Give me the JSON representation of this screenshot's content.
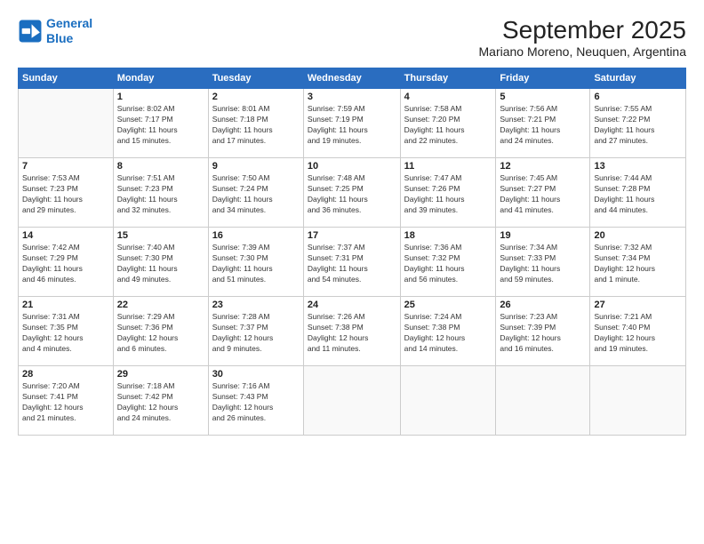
{
  "header": {
    "logo_line1": "General",
    "logo_line2": "Blue",
    "title": "September 2025",
    "subtitle": "Mariano Moreno, Neuquen, Argentina"
  },
  "days_of_week": [
    "Sunday",
    "Monday",
    "Tuesday",
    "Wednesday",
    "Thursday",
    "Friday",
    "Saturday"
  ],
  "weeks": [
    [
      {
        "num": "",
        "info": ""
      },
      {
        "num": "1",
        "info": "Sunrise: 8:02 AM\nSunset: 7:17 PM\nDaylight: 11 hours\nand 15 minutes."
      },
      {
        "num": "2",
        "info": "Sunrise: 8:01 AM\nSunset: 7:18 PM\nDaylight: 11 hours\nand 17 minutes."
      },
      {
        "num": "3",
        "info": "Sunrise: 7:59 AM\nSunset: 7:19 PM\nDaylight: 11 hours\nand 19 minutes."
      },
      {
        "num": "4",
        "info": "Sunrise: 7:58 AM\nSunset: 7:20 PM\nDaylight: 11 hours\nand 22 minutes."
      },
      {
        "num": "5",
        "info": "Sunrise: 7:56 AM\nSunset: 7:21 PM\nDaylight: 11 hours\nand 24 minutes."
      },
      {
        "num": "6",
        "info": "Sunrise: 7:55 AM\nSunset: 7:22 PM\nDaylight: 11 hours\nand 27 minutes."
      }
    ],
    [
      {
        "num": "7",
        "info": "Sunrise: 7:53 AM\nSunset: 7:23 PM\nDaylight: 11 hours\nand 29 minutes."
      },
      {
        "num": "8",
        "info": "Sunrise: 7:51 AM\nSunset: 7:23 PM\nDaylight: 11 hours\nand 32 minutes."
      },
      {
        "num": "9",
        "info": "Sunrise: 7:50 AM\nSunset: 7:24 PM\nDaylight: 11 hours\nand 34 minutes."
      },
      {
        "num": "10",
        "info": "Sunrise: 7:48 AM\nSunset: 7:25 PM\nDaylight: 11 hours\nand 36 minutes."
      },
      {
        "num": "11",
        "info": "Sunrise: 7:47 AM\nSunset: 7:26 PM\nDaylight: 11 hours\nand 39 minutes."
      },
      {
        "num": "12",
        "info": "Sunrise: 7:45 AM\nSunset: 7:27 PM\nDaylight: 11 hours\nand 41 minutes."
      },
      {
        "num": "13",
        "info": "Sunrise: 7:44 AM\nSunset: 7:28 PM\nDaylight: 11 hours\nand 44 minutes."
      }
    ],
    [
      {
        "num": "14",
        "info": "Sunrise: 7:42 AM\nSunset: 7:29 PM\nDaylight: 11 hours\nand 46 minutes."
      },
      {
        "num": "15",
        "info": "Sunrise: 7:40 AM\nSunset: 7:30 PM\nDaylight: 11 hours\nand 49 minutes."
      },
      {
        "num": "16",
        "info": "Sunrise: 7:39 AM\nSunset: 7:30 PM\nDaylight: 11 hours\nand 51 minutes."
      },
      {
        "num": "17",
        "info": "Sunrise: 7:37 AM\nSunset: 7:31 PM\nDaylight: 11 hours\nand 54 minutes."
      },
      {
        "num": "18",
        "info": "Sunrise: 7:36 AM\nSunset: 7:32 PM\nDaylight: 11 hours\nand 56 minutes."
      },
      {
        "num": "19",
        "info": "Sunrise: 7:34 AM\nSunset: 7:33 PM\nDaylight: 11 hours\nand 59 minutes."
      },
      {
        "num": "20",
        "info": "Sunrise: 7:32 AM\nSunset: 7:34 PM\nDaylight: 12 hours\nand 1 minute."
      }
    ],
    [
      {
        "num": "21",
        "info": "Sunrise: 7:31 AM\nSunset: 7:35 PM\nDaylight: 12 hours\nand 4 minutes."
      },
      {
        "num": "22",
        "info": "Sunrise: 7:29 AM\nSunset: 7:36 PM\nDaylight: 12 hours\nand 6 minutes."
      },
      {
        "num": "23",
        "info": "Sunrise: 7:28 AM\nSunset: 7:37 PM\nDaylight: 12 hours\nand 9 minutes."
      },
      {
        "num": "24",
        "info": "Sunrise: 7:26 AM\nSunset: 7:38 PM\nDaylight: 12 hours\nand 11 minutes."
      },
      {
        "num": "25",
        "info": "Sunrise: 7:24 AM\nSunset: 7:38 PM\nDaylight: 12 hours\nand 14 minutes."
      },
      {
        "num": "26",
        "info": "Sunrise: 7:23 AM\nSunset: 7:39 PM\nDaylight: 12 hours\nand 16 minutes."
      },
      {
        "num": "27",
        "info": "Sunrise: 7:21 AM\nSunset: 7:40 PM\nDaylight: 12 hours\nand 19 minutes."
      }
    ],
    [
      {
        "num": "28",
        "info": "Sunrise: 7:20 AM\nSunset: 7:41 PM\nDaylight: 12 hours\nand 21 minutes."
      },
      {
        "num": "29",
        "info": "Sunrise: 7:18 AM\nSunset: 7:42 PM\nDaylight: 12 hours\nand 24 minutes."
      },
      {
        "num": "30",
        "info": "Sunrise: 7:16 AM\nSunset: 7:43 PM\nDaylight: 12 hours\nand 26 minutes."
      },
      {
        "num": "",
        "info": ""
      },
      {
        "num": "",
        "info": ""
      },
      {
        "num": "",
        "info": ""
      },
      {
        "num": "",
        "info": ""
      }
    ]
  ]
}
